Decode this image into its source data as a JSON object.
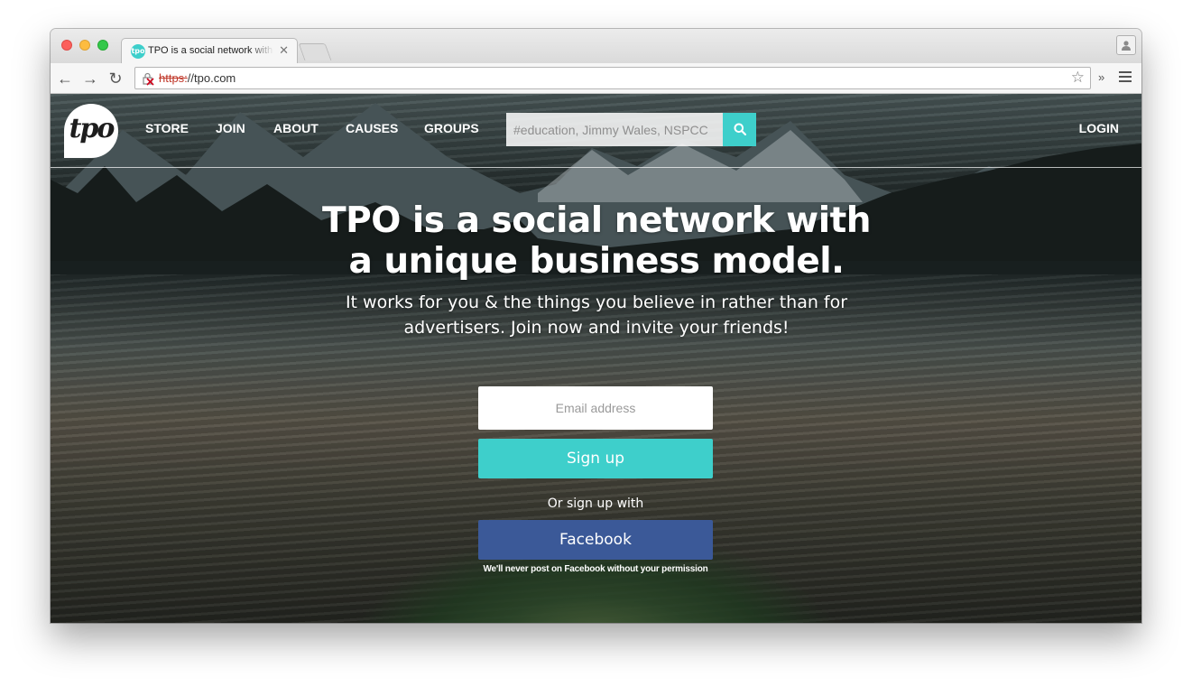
{
  "browser": {
    "tab_title": "TPO is a social network with a unique business model",
    "tab_favicon_text": "tpo",
    "url_scheme": "https:",
    "url_rest": "//tpo.com",
    "extensions_label": "»"
  },
  "site": {
    "logo_text": "tpo",
    "nav": [
      "STORE",
      "JOIN",
      "ABOUT",
      "CAUSES",
      "GROUPS"
    ],
    "search_placeholder": "#education, Jimmy Wales, NSPCC",
    "login_label": "LOGIN",
    "accent_color": "#3ecfcb",
    "facebook_color": "#3b5998"
  },
  "hero": {
    "headline_1": "TPO is a social network with",
    "headline_2": "a unique business model.",
    "sub_1": "It works for you & the things you believe in rather than for",
    "sub_2": "advertisers. Join now and invite your friends!",
    "email_placeholder": "Email address",
    "signup_label": "Sign up",
    "or_label": "Or sign up with",
    "facebook_label": "Facebook",
    "facebook_note": "We'll never post on Facebook without your permission"
  }
}
